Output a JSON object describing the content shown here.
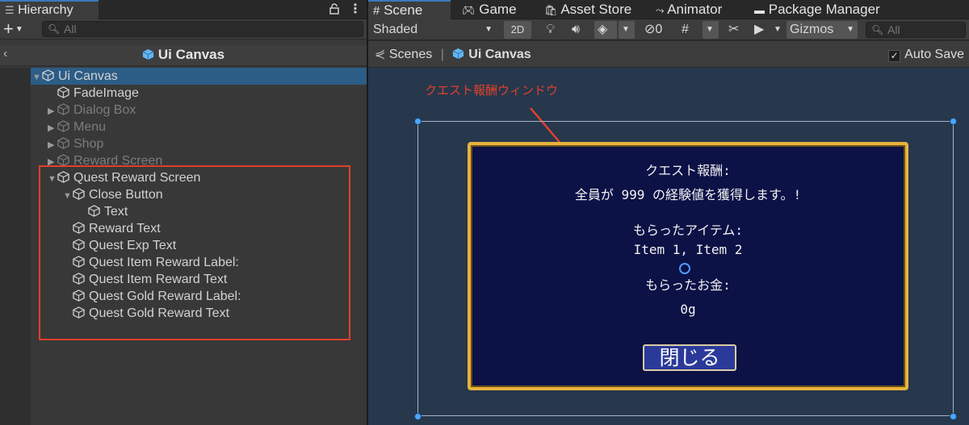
{
  "hierarchy": {
    "tab_label": "Hierarchy",
    "add_label": "+",
    "search_placeholder": "All",
    "breadcrumb_title": "Ui Canvas",
    "tree": [
      {
        "label": "Ui Canvas",
        "depth": 0,
        "arrow": "▼",
        "selected": true,
        "dim": false
      },
      {
        "label": "FadeImage",
        "depth": 1,
        "arrow": "",
        "selected": false,
        "dim": false
      },
      {
        "label": "Dialog Box",
        "depth": 1,
        "arrow": "▶",
        "selected": false,
        "dim": true
      },
      {
        "label": "Menu",
        "depth": 1,
        "arrow": "▶",
        "selected": false,
        "dim": true
      },
      {
        "label": "Shop",
        "depth": 1,
        "arrow": "▶",
        "selected": false,
        "dim": true
      },
      {
        "label": "Reward Screen",
        "depth": 1,
        "arrow": "▶",
        "selected": false,
        "dim": true
      },
      {
        "label": "Quest Reward Screen",
        "depth": 1,
        "arrow": "▼",
        "selected": false,
        "dim": false
      },
      {
        "label": "Close Button",
        "depth": 2,
        "arrow": "▼",
        "selected": false,
        "dim": false
      },
      {
        "label": "Text",
        "depth": 3,
        "arrow": "",
        "selected": false,
        "dim": false
      },
      {
        "label": "Reward Text",
        "depth": 2,
        "arrow": "",
        "selected": false,
        "dim": false
      },
      {
        "label": "Quest Exp Text",
        "depth": 2,
        "arrow": "",
        "selected": false,
        "dim": false
      },
      {
        "label": "Quest Item Reward Label:",
        "depth": 2,
        "arrow": "",
        "selected": false,
        "dim": false
      },
      {
        "label": "Quest Item Reward Text",
        "depth": 2,
        "arrow": "",
        "selected": false,
        "dim": false
      },
      {
        "label": "Quest Gold Reward Label:",
        "depth": 2,
        "arrow": "",
        "selected": false,
        "dim": false
      },
      {
        "label": "Quest Gold Reward Text",
        "depth": 2,
        "arrow": "",
        "selected": false,
        "dim": false
      }
    ]
  },
  "scene": {
    "tabs": [
      {
        "label": "Scene",
        "icon": "grid-icon"
      },
      {
        "label": "Game",
        "icon": "gamepad-icon"
      },
      {
        "label": "Asset Store",
        "icon": "bag-icon"
      },
      {
        "label": "Animator",
        "icon": "animator-icon"
      },
      {
        "label": "Package Manager",
        "icon": "package-icon"
      }
    ],
    "toolbar": {
      "shading_mode": "Shaded",
      "mode_2d": "2D",
      "hidden_count": "0",
      "gizmos": "Gizmos",
      "search_placeholder": "All"
    },
    "breadcrumb": {
      "scenes": "Scenes",
      "separator": "|",
      "current": "Ui Canvas"
    },
    "auto_save_label": "Auto Save",
    "auto_save_checked": true,
    "annotation": "クエスト報酬ウィンドウ",
    "dialog": {
      "title": "クエスト報酬:",
      "exp_text": "全員が 999 の経験値を獲得します。!",
      "item_label": "もらったアイテム:",
      "item_text": "Item 1, Item 2",
      "gold_label": "もらったお金:",
      "gold_text": "0g",
      "close_button": "閉じる"
    }
  },
  "colors": {
    "selection": "#2c5d87",
    "highlight_box": "#e0402a",
    "dialog_bg": "#0c1146",
    "dialog_border": "#e7b33c",
    "viewport_bg": "#27374c",
    "annotation": "#e3412d"
  }
}
